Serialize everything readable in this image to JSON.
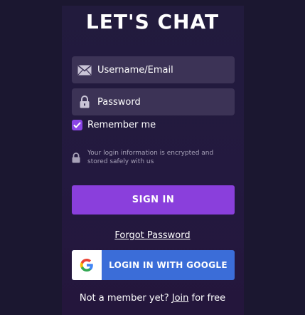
{
  "title": "LET'S CHAT",
  "username": {
    "placeholder": "Username/Email",
    "icon": "envelope-icon"
  },
  "password": {
    "placeholder": "Password",
    "icon": "lock-icon"
  },
  "remember": {
    "label": "Remember me",
    "checked": true
  },
  "security_note": {
    "text": "Your login information is encrypted and stored safely with us",
    "icon": "lock-icon"
  },
  "sign_in_label": "SIGN IN",
  "forgot_label": "Forgot Password",
  "google": {
    "label": "LOGIN IN WITH GOOGLE",
    "icon": "google-logo-icon"
  },
  "join": {
    "prefix": "Not a member yet?",
    "link": "Join",
    "suffix": "for free"
  },
  "colors": {
    "background": "#1b1730",
    "panel": "#221b3d",
    "field": "#3c3356",
    "accent_purple": "#8a3fdc",
    "google_blue": "#3b6dd8"
  }
}
